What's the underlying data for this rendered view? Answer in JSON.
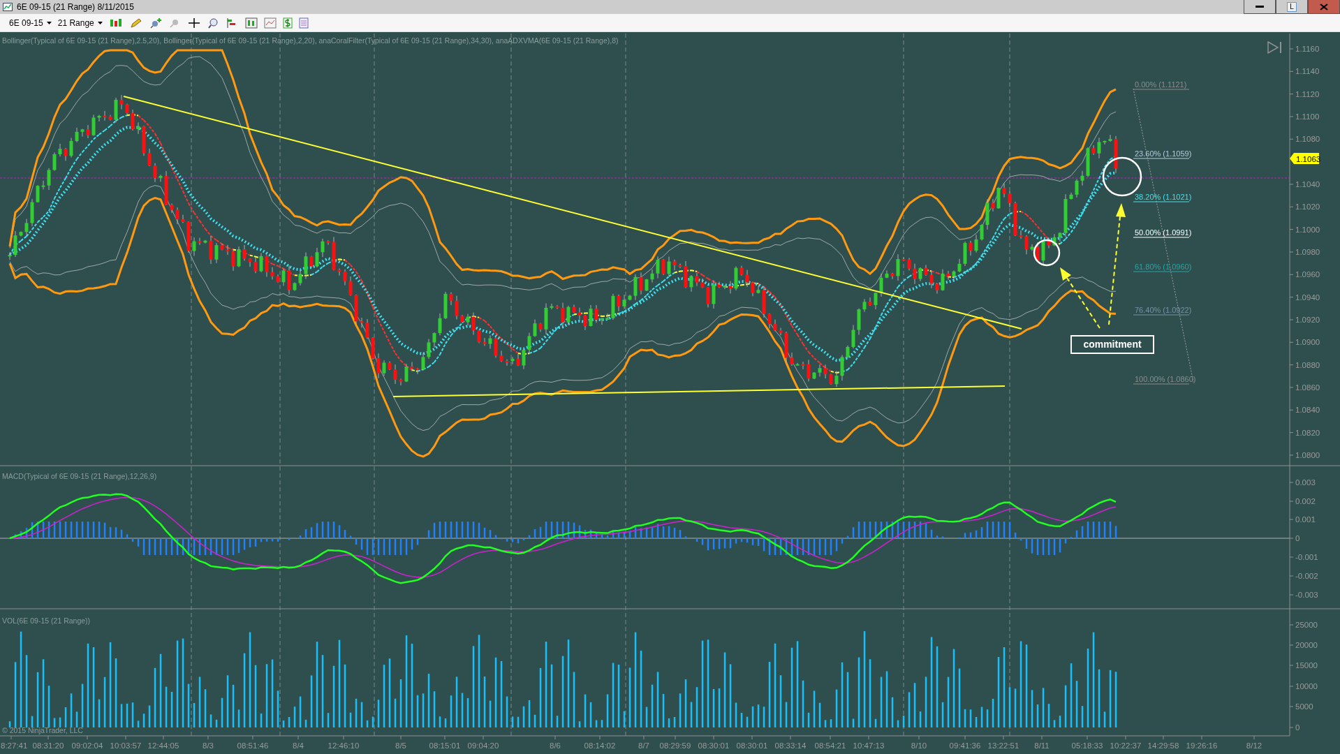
{
  "window": {
    "title": "6E 09-15 (21 Range)  8/11/2015",
    "button_badge": "L"
  },
  "toolbar": {
    "instrument": "6E 09-15",
    "period": "21 Range"
  },
  "price_panel": {
    "indicators_label": "Bollinger(Typical of 6E 09-15 (21 Range),2.5,20), Bollinger(Typical of 6E 09-15 (21 Range),2,20), anaCoralFilter(Typical of 6E 09-15 (21 Range),34,30), anaADXVMA(6E 09-15 (21 Range),8)",
    "axis": [
      "1.1160",
      "1.1140",
      "1.1120",
      "1.1100",
      "1.1080",
      "1.1040",
      "1.1020",
      "1.1000",
      "1.0980",
      "1.0960",
      "1.0940",
      "1.0920",
      "1.0900",
      "1.0880",
      "1.0860",
      "1.0840",
      "1.0820",
      "1.0800"
    ],
    "last_price": "1.1063",
    "fib_levels": [
      {
        "label": "0.00% (1.1121)",
        "color": "#8c8c8c"
      },
      {
        "label": "23.60% (1.1059)",
        "color": "#b8c8e0"
      },
      {
        "label": "38.20% (1.1021)",
        "color": "#40e0e8"
      },
      {
        "label": "50.00% (1.0991)",
        "color": "#ffffff"
      },
      {
        "label": "61.80% (1.0960)",
        "color": "#20a8a8"
      },
      {
        "label": "76.40% (1.0922)",
        "color": "#7890a8"
      },
      {
        "label": "100.00% (1.0860)",
        "color": "#8c8c8c"
      }
    ],
    "callout": "commitment"
  },
  "macd_panel": {
    "label": "MACD(Typical of 6E 09-15 (21 Range),12,26,9)",
    "axis": [
      "0.003",
      "0.002",
      "0.001",
      "0",
      "-0.001",
      "-0.002",
      "-0.003"
    ]
  },
  "volume_panel": {
    "label": "VOL(6E 09-15 (21 Range))",
    "axis": [
      "25000",
      "20000",
      "15000",
      "10000",
      "5000",
      "0"
    ],
    "copyright": "© 2015 NinjaTrader, LLC"
  },
  "time_axis": [
    "8:27:41",
    "08:31:20",
    "09:02:04",
    "10:03:57",
    "12:44:05",
    "8/3",
    "08:51:46",
    "8/4",
    "12:46:10",
    "8/5",
    "08:15:01",
    "09:04:20",
    "8/6",
    "08:14:02",
    "8/7",
    "08:29:59",
    "08:30:01",
    "08:30:01",
    "08:33:14",
    "08:54:21",
    "10:47:13",
    "8/10",
    "09:41:36",
    "13:22:51",
    "8/11",
    "05:18:33",
    "10:22:37",
    "14:29:58",
    "19:26:16",
    "8/12"
  ]
}
